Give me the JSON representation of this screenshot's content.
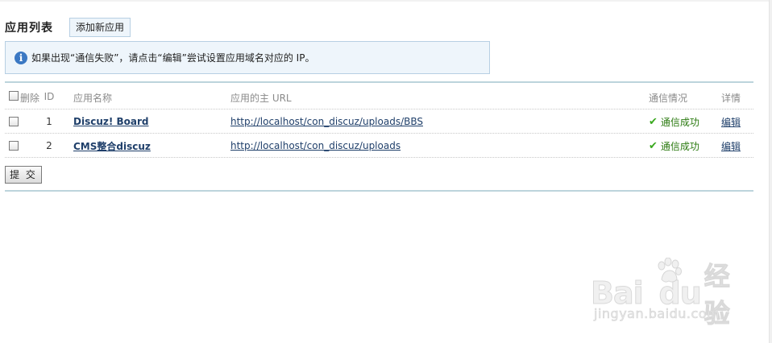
{
  "header": {
    "title": "应用列表",
    "add_button": "添加新应用"
  },
  "notice": {
    "icon": "info-icon",
    "text": "如果出现“通信失败”，请点击“编辑”尝试设置应用域名对应的 IP。"
  },
  "table": {
    "columns": {
      "delete": "删除",
      "id": "ID",
      "name": "应用名称",
      "url": "应用的主 URL",
      "status": "通信情况",
      "detail": "详情"
    },
    "rows": [
      {
        "id": "1",
        "name": "Discuz! Board",
        "url": "http://localhost/con_discuz/uploads/BBS",
        "status": "通信成功",
        "detail": "编辑"
      },
      {
        "id": "2",
        "name": "CMS整合discuz",
        "url": "http://localhost/con_discuz/uploads",
        "status": "通信成功",
        "detail": "编辑"
      }
    ]
  },
  "submit_label": "提 交",
  "watermark": {
    "logo_left": "Bai",
    "logo_right": "du",
    "logo_cn": "经验",
    "sub": "jingyan.baidu.com"
  },
  "colors": {
    "link": "#1f3f6a",
    "success": "#2b7a10",
    "notice_bg": "#eef5fb",
    "rule": "#bcd4dc"
  }
}
